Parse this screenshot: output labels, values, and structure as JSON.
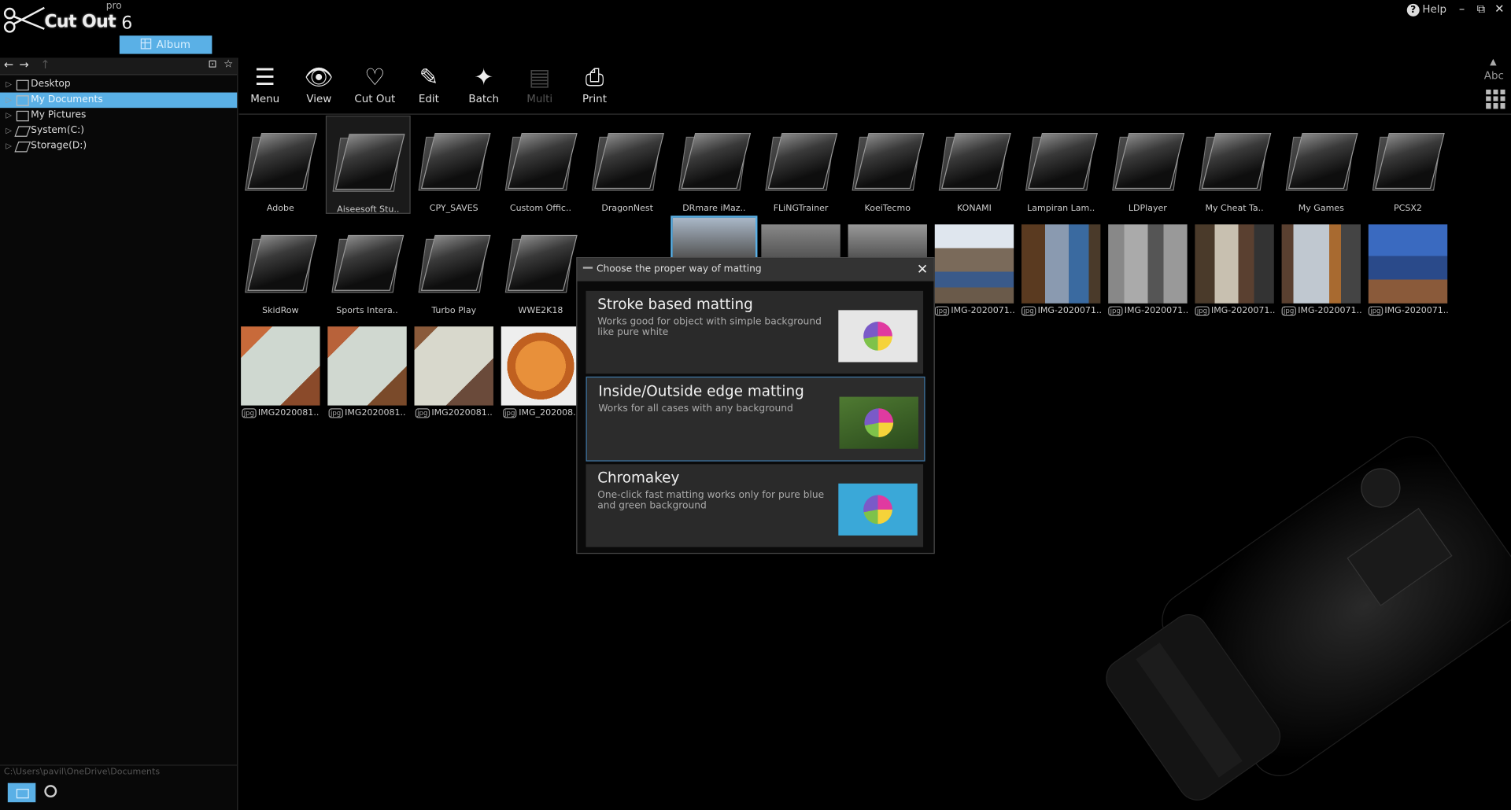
{
  "app": {
    "name": "Cut Out",
    "edition": "pro",
    "version": "6",
    "album_label": "Album",
    "help_label": "Help"
  },
  "window_controls": [
    "minimize",
    "restore",
    "close"
  ],
  "sidebar": {
    "tree": [
      {
        "label": "Desktop",
        "icon": "folder-icon",
        "selected": false
      },
      {
        "label": "My Documents",
        "icon": "documents-icon",
        "selected": true
      },
      {
        "label": "My Pictures",
        "icon": "pictures-icon",
        "selected": false
      },
      {
        "label": "System(C:)",
        "icon": "drive-icon",
        "selected": false
      },
      {
        "label": "Storage(D:)",
        "icon": "drive-icon",
        "selected": false
      }
    ],
    "path": "C:\\Users\\pavil\\OneDrive\\Documents"
  },
  "toolbar": {
    "items": [
      {
        "label": "Menu",
        "icon": "menu-icon",
        "enabled": true
      },
      {
        "label": "View",
        "icon": "eye-icon",
        "enabled": true
      },
      {
        "label": "Cut Out",
        "icon": "heart-cut-icon",
        "enabled": true
      },
      {
        "label": "Edit",
        "icon": "wand-icon",
        "enabled": true
      },
      {
        "label": "Batch",
        "icon": "batch-icon",
        "enabled": true
      },
      {
        "label": "Multi",
        "icon": "multi-icon",
        "enabled": false
      },
      {
        "label": "Print",
        "icon": "printer-icon",
        "enabled": true
      }
    ],
    "view_text_label": "Abc"
  },
  "folders_row1": [
    "Adobe",
    "Aiseesoft Stu..",
    "CPY_SAVES",
    "Custom Offic..",
    "DragonNest",
    "DRmare iMaz..",
    "FLiNGTrainer",
    "KoeiTecmo",
    "KONAMI",
    "Lampiran Lam..",
    "LDPlayer",
    "My Cheat Ta..",
    "My Games",
    "PCSX2"
  ],
  "folders_row2": [
    "SkidRow",
    "Sports Intera..",
    "Turbo Play",
    "WWE2K18"
  ],
  "photos_row2": [
    "IMG-2020071..",
    "IMG-2020071..",
    "IMG-2020071..",
    "IMG-2020071..",
    "IMG-2020071..",
    "IMG-2020071.."
  ],
  "photos_row3": [
    "IMG2020081..",
    "IMG2020081..",
    "IMG2020081..",
    "IMG_202008.."
  ],
  "dialog": {
    "title": "Choose the proper way of matting",
    "options": [
      {
        "heading": "Stroke based matting",
        "desc": "Works good for object with simple background like pure white",
        "bg": "#e6e6e6",
        "selected": false
      },
      {
        "heading": "Inside/Outside edge matting",
        "desc": "Works for all cases with any background",
        "bg": "#3e6a2a",
        "selected": true
      },
      {
        "heading": "Chromakey",
        "desc": "One-click fast matting works only for pure blue and green background",
        "bg": "#3aa8d8",
        "selected": false
      }
    ]
  },
  "colors": {
    "accent": "#5ab0e6",
    "background": "#000000",
    "dialog_border": "#3f78a8"
  }
}
